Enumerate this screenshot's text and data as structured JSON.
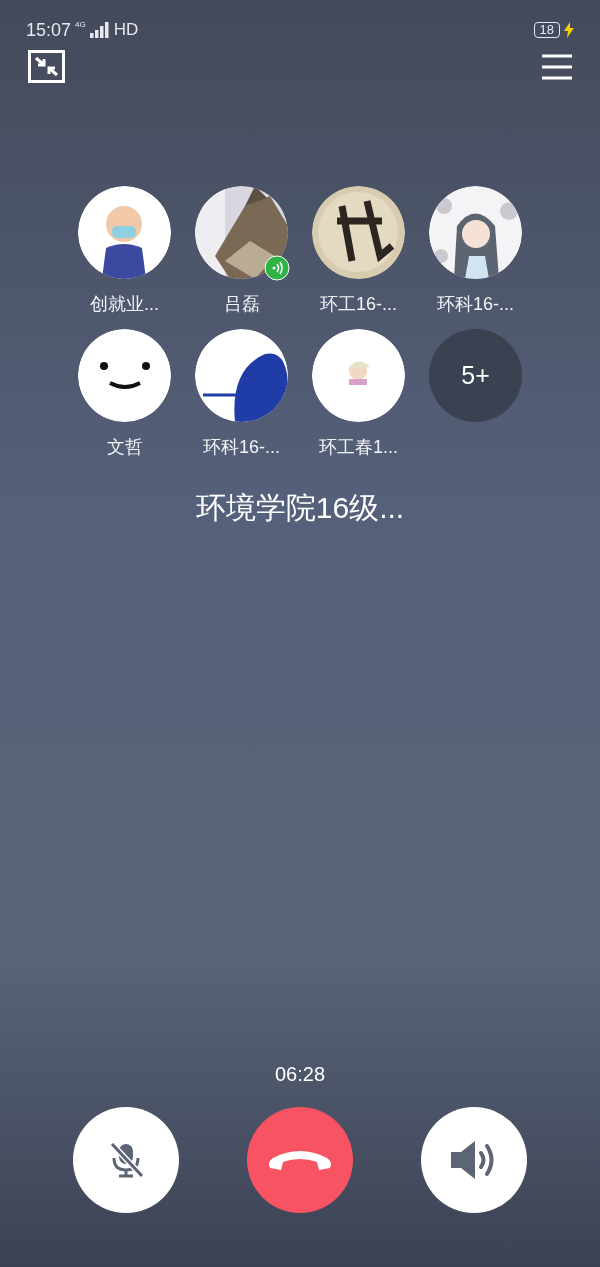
{
  "status_bar": {
    "time": "15:07",
    "network": "4G",
    "hd": "HD",
    "battery": "18",
    "charging": true
  },
  "participants": [
    {
      "kind": "avatar",
      "name": "创就业...",
      "speaking": false
    },
    {
      "kind": "avatar",
      "name": "吕磊",
      "speaking": true
    },
    {
      "kind": "avatar",
      "name": "环工16-...",
      "speaking": false
    },
    {
      "kind": "avatar",
      "name": "环科16-...",
      "speaking": false
    },
    {
      "kind": "avatar",
      "name": "文哲",
      "speaking": false
    },
    {
      "kind": "avatar",
      "name": "环科16-...",
      "speaking": false
    },
    {
      "kind": "avatar",
      "name": "环工春1...",
      "speaking": false
    },
    {
      "kind": "more",
      "label": "5+"
    }
  ],
  "group_name": "环境学院16级...",
  "call_timer": "06:28",
  "controls": [
    {
      "kind": "mute",
      "muted": true
    },
    {
      "kind": "hangup"
    },
    {
      "kind": "speaker"
    }
  ]
}
